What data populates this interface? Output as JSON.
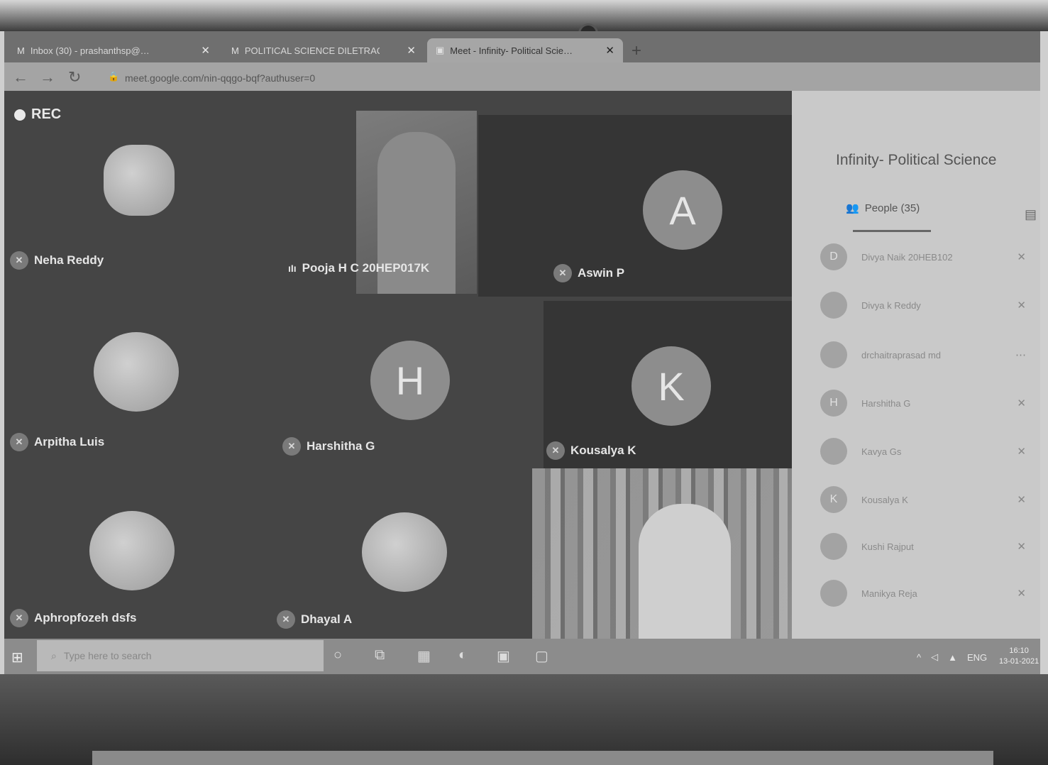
{
  "browser": {
    "tabs": [
      {
        "icon": "M",
        "title": "Inbox (30) - prashanthsp@…",
        "active": false
      },
      {
        "icon": "M",
        "title": "POLITICAL SCIENCE DILETRACK…",
        "active": false
      },
      {
        "icon": "meet-icon",
        "title": "Meet - Infinity- Political Scie…",
        "active": true
      }
    ],
    "url": "meet.google.com/nin-qqgo-bqf?authuser=0"
  },
  "meet": {
    "rec_label": "REC",
    "participants": [
      {
        "name": "Neha Reddy",
        "avatar": "photo",
        "muted": true
      },
      {
        "name": "Pooja H C 20HEP017K",
        "avatar": "video",
        "muted": false
      },
      {
        "name": "Aswin P",
        "avatar": "A",
        "muted": true
      },
      {
        "name": "Arpitha Luis",
        "avatar": "photo",
        "muted": true
      },
      {
        "name": "Harshitha G",
        "avatar": "H",
        "muted": true
      },
      {
        "name": "Kousalya K",
        "avatar": "K",
        "muted": true
      },
      {
        "name": "Aphropfozeh dsfs",
        "avatar": "photo",
        "muted": true
      },
      {
        "name": "Dhayal A",
        "avatar": "photo",
        "muted": true
      }
    ]
  },
  "panel": {
    "title": "Infinity- Political Science",
    "people_tab": "People (35)",
    "people": [
      {
        "initial": "D",
        "name": "Divya Naik 20HEB102"
      },
      {
        "initial": "",
        "name": "Divya k Reddy"
      },
      {
        "initial": "",
        "name": "drchaitraprasad md"
      },
      {
        "initial": "H",
        "name": "Harshitha G"
      },
      {
        "initial": "",
        "name": "Kavya Gs"
      },
      {
        "initial": "K",
        "name": "Kousalya K"
      },
      {
        "initial": "",
        "name": "Kushi Rajput"
      },
      {
        "initial": "",
        "name": "Manikya Reja"
      }
    ]
  },
  "taskbar": {
    "search_placeholder": "Type here to search",
    "tray_lang": "ENG",
    "time": "16:10",
    "date": "13-01-2021"
  }
}
